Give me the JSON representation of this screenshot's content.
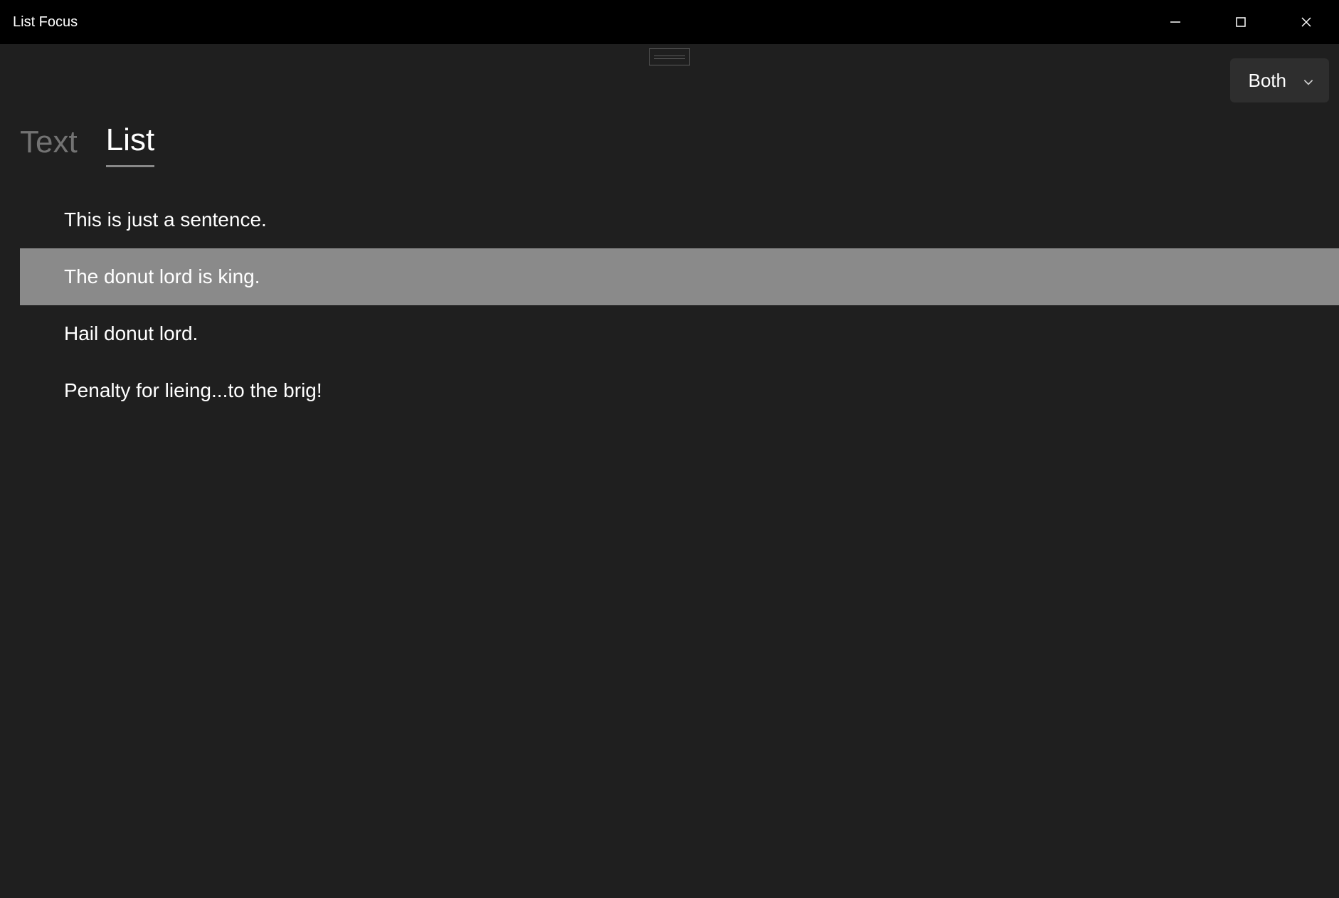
{
  "window": {
    "title": "List Focus"
  },
  "dropdown": {
    "selected": "Both"
  },
  "tabs": [
    {
      "label": "Text",
      "active": false
    },
    {
      "label": "List",
      "active": true
    }
  ],
  "list": {
    "items": [
      {
        "text": "This is just a sentence.",
        "selected": false
      },
      {
        "text": "The donut lord is king.",
        "selected": true
      },
      {
        "text": "Hail donut lord.",
        "selected": false
      },
      {
        "text": "Penalty for lieing...to the brig!",
        "selected": false
      }
    ]
  }
}
